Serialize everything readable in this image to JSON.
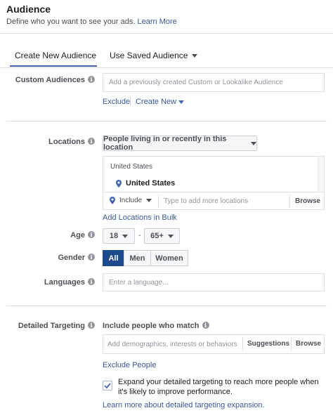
{
  "header": {
    "title": "Audience",
    "subtitle": "Define who you want to see your ads.",
    "learn_more": "Learn More"
  },
  "tabs": [
    {
      "label": "Create New Audience",
      "active": true
    },
    {
      "label": "Use Saved Audience",
      "active": false
    }
  ],
  "custom_audiences": {
    "label": "Custom Audiences",
    "placeholder": "Add a previously created Custom or Lookalike Audience",
    "exclude": "Exclude",
    "create_new": "Create New"
  },
  "locations": {
    "label": "Locations",
    "mode": "People living in or recently in this location",
    "group_header": "United States",
    "selected": "United States",
    "include": "Include",
    "placeholder": "Type to add more locations",
    "browse": "Browse",
    "bulk_link": "Add Locations in Bulk"
  },
  "age": {
    "label": "Age",
    "min": "18",
    "separator": "-",
    "max": "65+"
  },
  "gender": {
    "label": "Gender",
    "options": [
      "All",
      "Men",
      "Women"
    ],
    "selected": "All"
  },
  "languages": {
    "label": "Languages",
    "placeholder": "Enter a language..."
  },
  "detailed_targeting": {
    "label": "Detailed Targeting",
    "include_label": "Include people who match",
    "placeholder": "Add demographics, interests or behaviors",
    "suggestions": "Suggestions",
    "browse": "Browse",
    "exclude_link": "Exclude People",
    "expand_checked": true,
    "expand_text": "Expand your detailed targeting to reach more people when it's likely to improve performance.",
    "learn_more": "Learn more about detailed targeting expansion."
  },
  "colors": {
    "accent": "#4267b2",
    "link": "#365899",
    "active_segment": "#1d4a8c"
  }
}
